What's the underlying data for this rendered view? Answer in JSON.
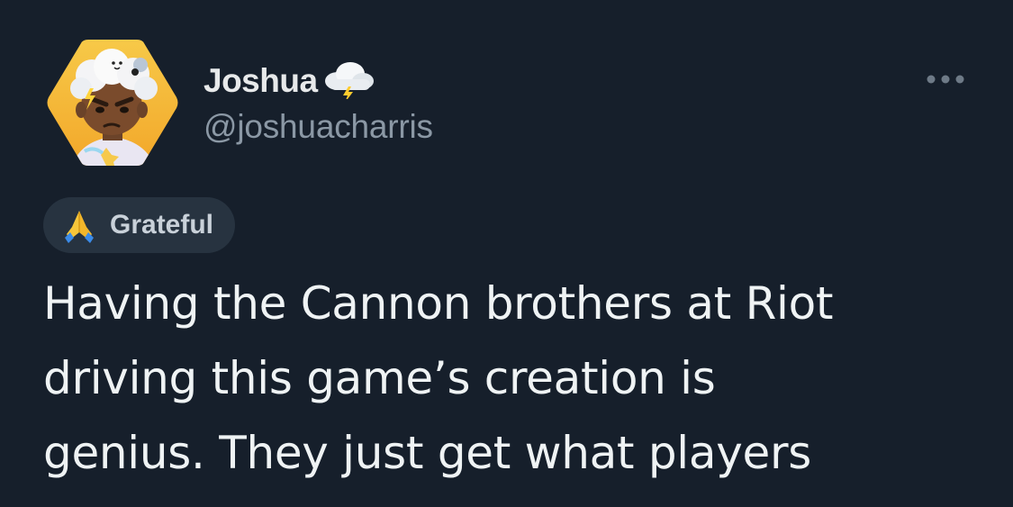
{
  "user": {
    "display_name": "Joshua",
    "handle": "@joshuacharris",
    "name_emoji_icon": "cloud-with-lightning-icon",
    "avatar_icon": "cartoon-avatar-with-storm-cloud"
  },
  "header": {
    "more_icon": "more-horizontal-icon"
  },
  "mood": {
    "icon": "folded-hands-icon",
    "label": "Grateful"
  },
  "tweet": {
    "text": "Having the Cannon brothers at Riot\ndriving this game’s creation is\ngenius. They just get what players"
  },
  "colors": {
    "background": "#161f2b",
    "primary_text": "#e7e9ea",
    "secondary_text": "#8b98a5",
    "badge_background": "#273340"
  }
}
